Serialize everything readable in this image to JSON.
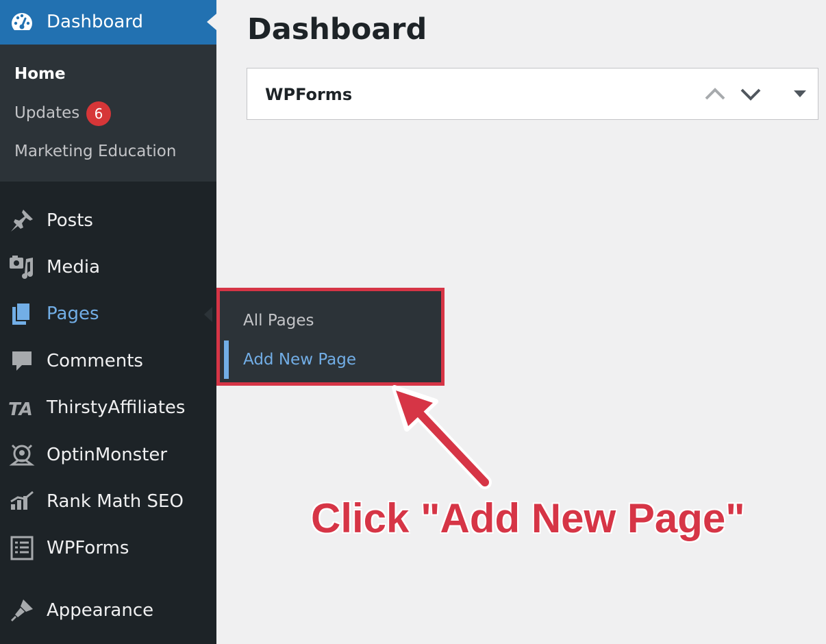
{
  "sidebar": {
    "dashboard": {
      "label": "Dashboard",
      "icon": "dashboard-gauge-icon"
    },
    "dashboard_sub": {
      "home": "Home",
      "updates": "Updates",
      "updates_count": "6",
      "marketing": "Marketing Education"
    },
    "items": [
      {
        "label": "Posts",
        "icon": "pin-icon"
      },
      {
        "label": "Media",
        "icon": "media-icon"
      },
      {
        "label": "Pages",
        "icon": "pages-icon",
        "active": true
      },
      {
        "label": "Comments",
        "icon": "comment-icon"
      },
      {
        "label": "ThirstyAffiliates",
        "icon": "thirstyaffiliates-icon"
      },
      {
        "label": "OptinMonster",
        "icon": "optinmonster-icon"
      },
      {
        "label": "Rank Math SEO",
        "icon": "rank-math-icon"
      },
      {
        "label": "WPForms",
        "icon": "wpforms-icon"
      },
      {
        "label": "Appearance",
        "icon": "paintbrush-icon"
      }
    ],
    "pages_flyout": {
      "all_pages": "All Pages",
      "add_new_page": "Add New Page"
    }
  },
  "main": {
    "title": "Dashboard",
    "widget": {
      "title": "WPForms"
    }
  },
  "annotation": {
    "text": "Click \"Add New Page\"",
    "color": "#d63546"
  },
  "colors": {
    "sidebar_bg": "#1d2327",
    "accent": "#2271b1",
    "highlight_text": "#72aee6"
  }
}
